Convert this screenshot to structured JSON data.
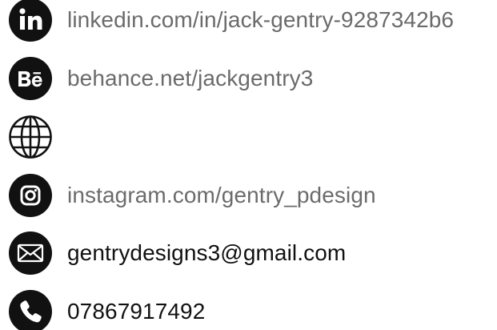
{
  "contacts": [
    {
      "icon": "linkedin-icon",
      "text": "linkedin.com/in/jack-gentry-9287342b6"
    },
    {
      "icon": "behance-icon",
      "text": "behance.net/jackgentry3"
    },
    {
      "icon": "globe-icon",
      "text": ""
    },
    {
      "icon": "instagram-icon",
      "text": "instagram.com/gentry_pdesign"
    },
    {
      "icon": "email-icon",
      "text": "gentrydesigns3@gmail.com"
    },
    {
      "icon": "phone-icon",
      "text": "07867917492"
    }
  ],
  "colors": {
    "icon_bg": "#111111",
    "text_muted": "#6b6b6b",
    "text_dark": "#111111"
  }
}
